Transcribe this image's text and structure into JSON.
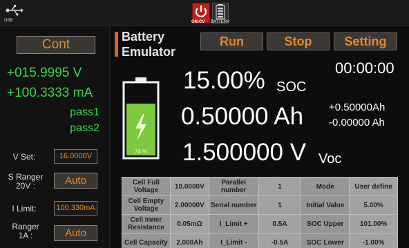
{
  "statusbar": {
    "usb_label": "USB",
    "oncv_label": "ON-CV",
    "battery_label": "BATTERY",
    "icons": [
      "usb-icon",
      "power-icon",
      "battery-icon"
    ]
  },
  "left": {
    "cont_label": "Cont",
    "voltage": "+015.9995 V",
    "current": "+100.3333 mA",
    "pass1": "pass1",
    "pass2": "pass2",
    "vset_label": "V Set:",
    "vset_value": "16.0000V",
    "sranger_label": "S Ranger 20V :",
    "sranger_value": "Auto",
    "ilimit_label": "I Limit:",
    "ilimit_value": "100.330mA",
    "ranger_label": "Ranger 1A :",
    "ranger_value": "Auto"
  },
  "header": {
    "title_line1": "Battery",
    "title_line2": "Emulator",
    "run_label": "Run",
    "stop_label": "Stop",
    "setting_label": "Setting",
    "clock": "00:00:00"
  },
  "battery": {
    "level_percent": 74,
    "level_text": "74 %"
  },
  "readings": {
    "soc_value": "15.00%",
    "soc_unit": "SOC",
    "ah_value": "0.50000 Ah",
    "cap_pos": "+0.50000Ah",
    "cap_neg": "-0.00000 Ah",
    "voc_value": "1.500000 V",
    "voc_unit": "Voc"
  },
  "table": {
    "rows": [
      [
        "Cell Full Voltage",
        "10.0000V",
        "Parallel number",
        "1",
        "Mode",
        "User define"
      ],
      [
        "Cell Empty Voltage",
        "2.00000V",
        "Serial number",
        "1",
        "Initial Value",
        "5.00%"
      ],
      [
        "Cell Inner Resistance",
        "0.05mΩ",
        "I_Limit +",
        "0.5A",
        "SOC Upper",
        "101.00%"
      ],
      [
        "Cell Capacity",
        "2.000Ah",
        "I_Limit -",
        "-0.5A",
        "SOC Lower",
        "-1.00%"
      ]
    ]
  },
  "colors": {
    "accent": "#e08a2c",
    "green": "#3fd44e",
    "alert_red": "#c0201b"
  }
}
